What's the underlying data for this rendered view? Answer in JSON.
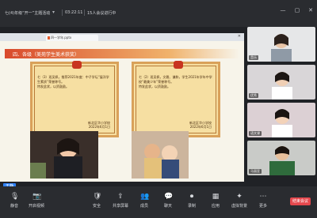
{
  "titlebar": {
    "meeting_title": "七(4)年级“开一”主题活动",
    "time": "03:22:11",
    "participants": "15人会议进行中",
    "controls": [
      "minimize-icon",
      "restore-icon",
      "close-icon"
    ]
  },
  "slide": {
    "tab_title": "四一学年.pptx",
    "heading": "四、各级（美苑学生美术获奖）",
    "certificates": [
      {
        "text": "七（3）班吴佩，推荐2021年度：中子学坛“展洋学生素质”荣誉称号。",
        "footer": "特发此状，以资鼓励。",
        "school": "新北区华小学校",
        "date": "2022年6月1日"
      },
      {
        "text": "七（2）班吴佩，文雅、谦和，学生2021年学年中学校“最美少年”荣誉称号。",
        "footer": "特发此状，以资鼓励。",
        "school": "新北区华小学校",
        "date": "2022年6月1日"
      }
    ]
  },
  "participants": {
    "tiles": [
      {
        "name": "音乐",
        "color": "#e6e7e8"
      },
      {
        "name": "优秀",
        "color": "#d9d6d8"
      },
      {
        "name": "语文课",
        "color": "#dcd0d4"
      },
      {
        "name": "马丽亚",
        "color": "#c9cbc8"
      }
    ]
  },
  "self": {
    "label": "王静"
  },
  "toolbar": {
    "left_items": [
      {
        "icon": "microphone-icon",
        "label": "静音"
      },
      {
        "icon": "video-camera-icon",
        "label": "开启视频"
      }
    ],
    "center_items": [
      {
        "icon": "shield-icon",
        "label": "安全"
      },
      {
        "icon": "share-screen-icon",
        "label": "共享屏幕"
      },
      {
        "icon": "people-icon",
        "label": "成员"
      },
      {
        "icon": "chat-icon",
        "label": "聊天"
      },
      {
        "icon": "record-icon",
        "label": "录制"
      },
      {
        "icon": "apps-icon",
        "label": "应用"
      },
      {
        "icon": "effects-icon",
        "label": "虚拟背景"
      },
      {
        "icon": "more-icon",
        "label": "更多"
      }
    ],
    "end_label": "结束会议"
  }
}
